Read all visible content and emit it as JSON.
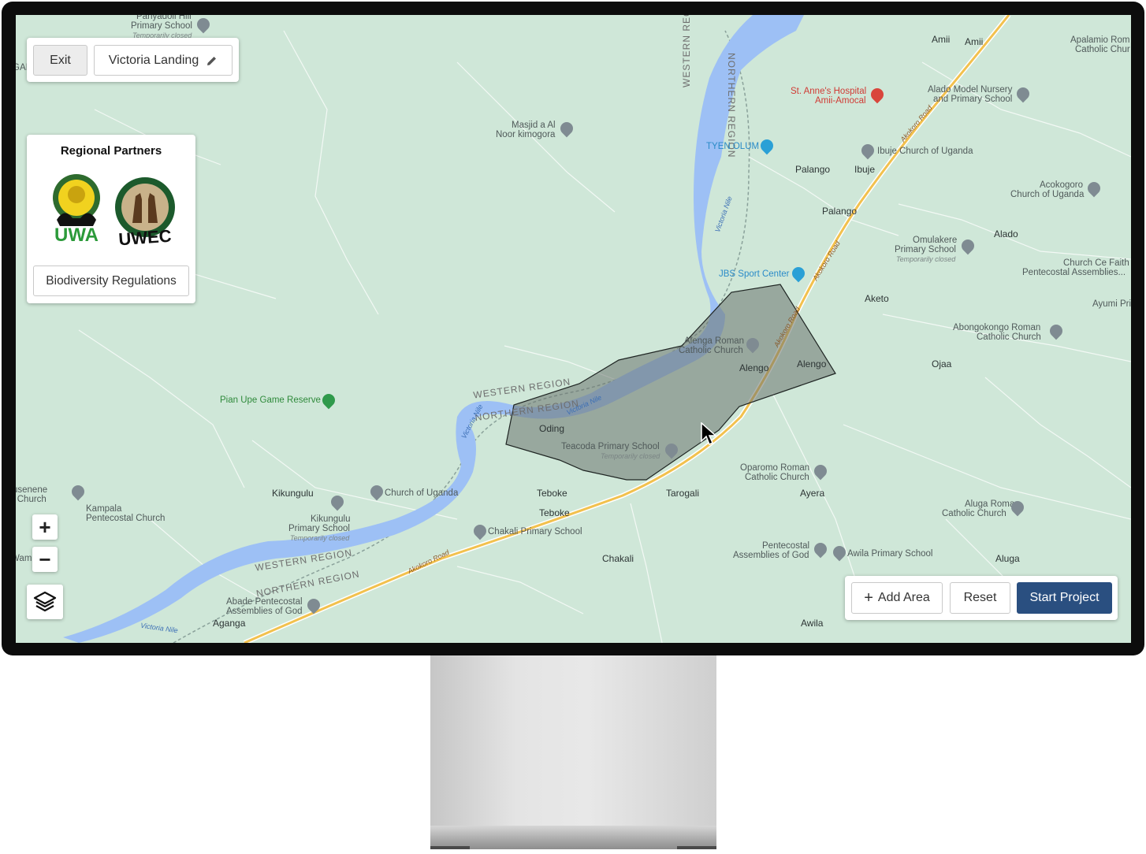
{
  "toolbar": {
    "exit_label": "Exit",
    "project_name": "Victoria Landing"
  },
  "partners": {
    "title": "Regional Partners",
    "uwa_text": "UWA",
    "uwec_text": "UWEC",
    "regulations_label": "Biodiversity Regulations"
  },
  "zoom": {
    "in_label": "+",
    "out_label": "−"
  },
  "actions": {
    "add_area_label": "Add Area",
    "reset_label": "Reset",
    "start_label": "Start Project"
  },
  "map": {
    "labels": {
      "panyadoli": "Panyadoli Hill",
      "panyadoli_school": "Primary School",
      "temp_closed_1": "Temporarily closed",
      "amii1": "Amii",
      "amii2": "Amii",
      "apalamio": "Apalamio Rom",
      "apalamio2": "Catholic Chur",
      "st_annes": "St. Anne's Hospital",
      "amii_amocal": "Amii-Amocal",
      "alado_nursery": "Alado Model Nursery",
      "alado_nursery2": "and Primary School",
      "masjid": "Masjid a Al",
      "masjid2": "Noor kimogora",
      "tyen_olum": "TYEN OLUM",
      "ibuje_church": "Ibuje Church of Uganda",
      "palango1": "Palango",
      "ibuje": "Ibuje",
      "palango2": "Palango",
      "acokogoro": "Acokogoro",
      "acokogoro2": "Church of Uganda",
      "alado": "Alado",
      "omulakere": "Omulakere",
      "omulakere2": "Primary School",
      "temp_closed_2": "Temporarily closed",
      "church_ce": "Church Ce Faith",
      "church_ce2": "Pentecostal Assemblies...",
      "jbs": "JBS Sport Center",
      "aketo": "Aketo",
      "ayumi": "Ayumi Prima",
      "abongokongo": "Abongokongo Roman",
      "abongokongo2": "Catholic Church",
      "alenga_church": "Alenga Roman",
      "alenga_church2": "Catholic Church",
      "alengo1": "Alengo",
      "alengo2": "Alengo",
      "ojaa": "Ojaa",
      "pian_upe": "Pian Upe Game Reserve",
      "oding": "Oding",
      "teacoda": "Teacoda Primary School",
      "temp_closed_3": "Temporarily closed",
      "usenene": "usenene",
      "l_church": "l Church",
      "kikungulu": "Kikungulu",
      "church_uganda": "Church of Uganda",
      "kampala_pent": "Kampala",
      "kampala_pent2": "Pentecostal Church",
      "kikungulu_school": "Kikungulu",
      "kikungulu_school2": "Primary School",
      "temp_closed_4": "Temporarily closed",
      "teboke1": "Teboke",
      "teboke2": "Teboke",
      "tarogali": "Tarogali",
      "oparomo": "Oparomo Roman",
      "oparomo2": "Catholic Church",
      "ayera": "Ayera",
      "aluga_church": "Aluga Roman",
      "aluga_church2": "Catholic Church",
      "chakali_school": "Chakali Primary School",
      "chakali": "Chakali",
      "pentecostal_aog": "Pentecostal",
      "pentecostal_aog2": "Assemblies of God",
      "awila_school": "Awila Primary School",
      "aluga": "Aluga",
      "wami": "Wami",
      "abade": "Abade Pentecostal",
      "abade2": "Assemblies of God",
      "aganga": "Aganga",
      "awila": "Awila",
      "gai": "GAI",
      "western_region_1": "WESTERN REGION",
      "northern_region_1": "NORTHERN REGION",
      "western_region_2": "WESTERN REGION",
      "northern_region_2": "NORTHERN REGION",
      "western_region_3": "WESTERN REGION",
      "northern_region_3": "NORTHERN REGION",
      "victoria_nile_1": "Victoria Nile",
      "victoria_nile_2": "Victoria Nile",
      "victoria_nile_3": "Victoria Nile",
      "victoria_nile_4": "Victoria Nile",
      "akokoro_1": "Akokoro Road",
      "akokoro_2": "Akokoro Road",
      "akokoro_3": "Akokoro Road",
      "akokoro_4": "Akokoro Road"
    }
  },
  "colors": {
    "land": "#cfe7d8",
    "water": "#9dc0f5",
    "road": "#f2c14e",
    "polygon": "#6b7570",
    "primary": "#2a4f80"
  }
}
